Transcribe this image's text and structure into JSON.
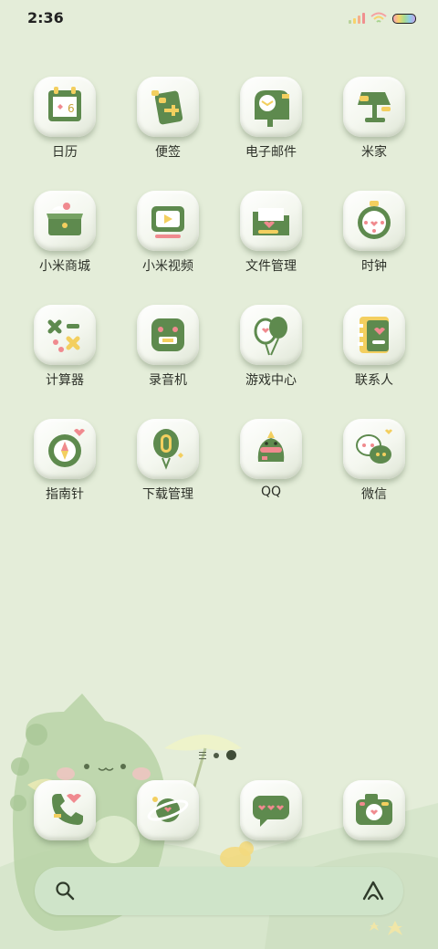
{
  "status_bar": {
    "time": "2:36",
    "icons": [
      "signal-icon",
      "wifi-icon",
      "battery-icon"
    ]
  },
  "apps": [
    {
      "label": "日历",
      "icon": "calendar-icon"
    },
    {
      "label": "便签",
      "icon": "notes-icon"
    },
    {
      "label": "电子邮件",
      "icon": "email-icon"
    },
    {
      "label": "米家",
      "icon": "lamp-icon"
    },
    {
      "label": "小米商城",
      "icon": "shop-box-icon"
    },
    {
      "label": "小米视频",
      "icon": "video-tv-icon"
    },
    {
      "label": "文件管理",
      "icon": "folder-icon"
    },
    {
      "label": "时钟",
      "icon": "alarm-clock-icon"
    },
    {
      "label": "计算器",
      "icon": "calculator-icon"
    },
    {
      "label": "录音机",
      "icon": "recorder-icon"
    },
    {
      "label": "游戏中心",
      "icon": "balloon-icon"
    },
    {
      "label": "联系人",
      "icon": "contacts-book-icon"
    },
    {
      "label": "指南针",
      "icon": "compass-icon"
    },
    {
      "label": "下载管理",
      "icon": "download-icon"
    },
    {
      "label": "QQ",
      "icon": "dino-qq-icon"
    },
    {
      "label": "微信",
      "icon": "wechat-icon"
    }
  ],
  "calendar_day": "6",
  "dock": [
    {
      "icon": "phone-icon"
    },
    {
      "icon": "browser-planet-icon"
    },
    {
      "icon": "messages-icon"
    },
    {
      "icon": "camera-icon"
    }
  ],
  "colors": {
    "background": "#e4edd9",
    "icon_green": "#5e8a4e",
    "accent_pink": "#f08a8f",
    "accent_yellow": "#f3cf5f",
    "search_bar": "#cfe4c9"
  }
}
